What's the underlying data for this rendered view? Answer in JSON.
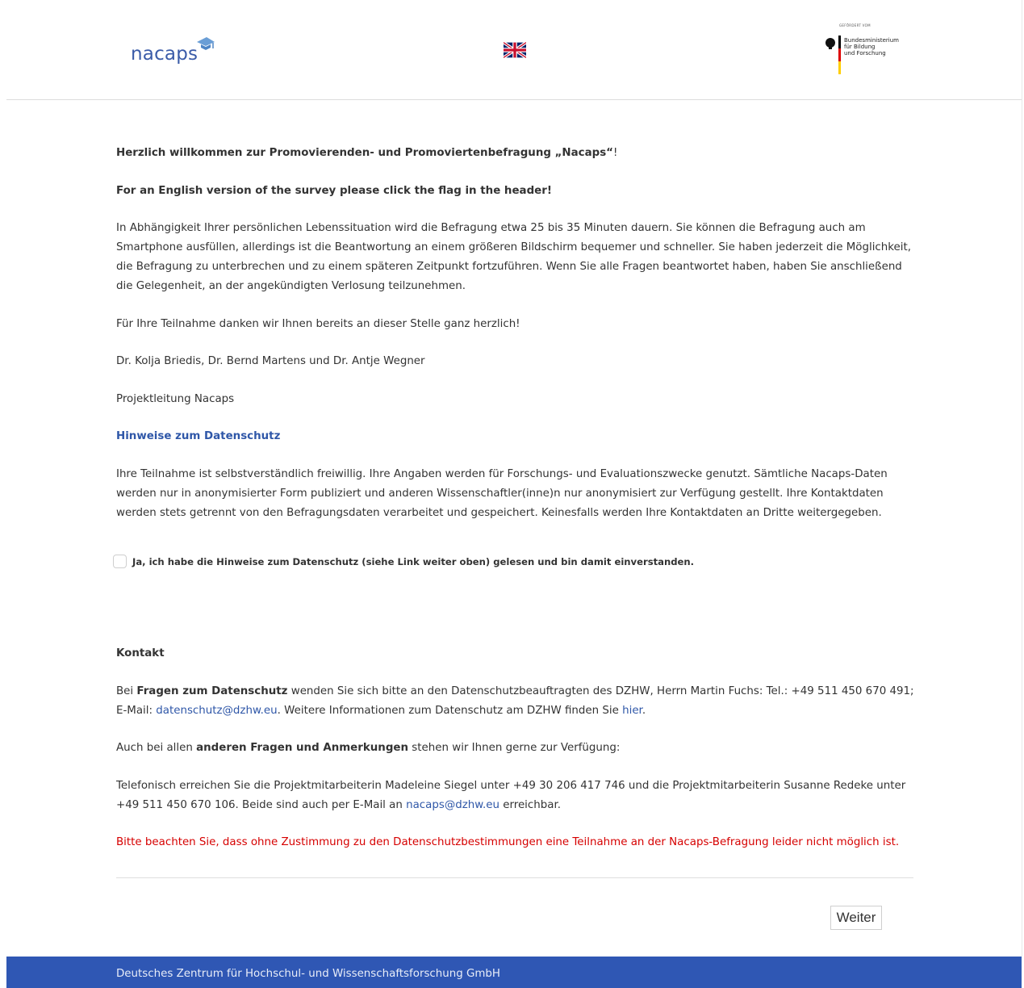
{
  "header": {
    "logo_text": "nacaps",
    "flag_icon": "uk-flag-icon",
    "bmbf": {
      "top_text": "GEFÖRDERT VOM",
      "name_lines": "Bundesministerium\nfür Bildung\nund Forschung"
    }
  },
  "intro": {
    "welcome_prefix": "Herzlich willkommen zur Promovierenden- und Promoviertenbefragung „Nacaps“",
    "welcome_suffix": "!",
    "english_note": "For an English version of the survey please click the flag in the header!",
    "paragraph1": "In Abhängigkeit Ihrer persönlichen Lebenssituation wird die Befragung etwa 25 bis 35 Minuten dauern. Sie können die Befragung auch am Smartphone ausfüllen, allerdings ist die Beantwortung an einem größeren Bildschirm bequemer und schneller. Sie haben jederzeit die Möglichkeit, die Befragung zu unterbrechen und zu einem späteren Zeitpunkt fortzuführen. Wenn Sie alle Fragen beantwortet haben, haben Sie anschließend die Gelegenheit, an der angekündigten Verlosung teilzunehmen.",
    "thanks": "Für Ihre Teilnahme danken wir Ihnen bereits an dieser Stelle ganz herzlich!",
    "signatories": "Dr. Kolja Briedis, Dr. Bernd Martens und Dr. Antje Wegner",
    "role": "Projektleitung Nacaps",
    "privacy_link": "Hinweise zum Datenschutz",
    "privacy_text": "Ihre Teilnahme ist selbstverständlich freiwillig. Ihre Angaben werden für Forschungs- und Evaluationszwecke genutzt. Sämtliche Nacaps-Daten werden nur in anonymisierter Form publiziert und anderen Wissenschaftler(inne)n nur anonymisiert zur Verfügung gestellt. Ihre Kontaktdaten werden stets getrennt von den Befragungsdaten verarbeitet und gespeichert. Keinesfalls werden Ihre Kontaktdaten an Dritte weitergegeben."
  },
  "consent": {
    "checked": false,
    "label": "Ja, ich habe die Hinweise zum Datenschutz (siehe Link weiter oben) gelesen und bin damit einverstanden."
  },
  "contact": {
    "heading": "Kontakt",
    "p1_a": "Bei ",
    "p1_bold": "Fragen zum Datenschutz",
    "p1_b": " wenden Sie sich bitte an den Datenschutzbeauftragten des DZHW, Herrn Martin Fuchs: Tel.: +49 511 450 670 491; E-Mail: ",
    "p1_email": "datenschutz@dzhw.eu",
    "p1_c": ". Weitere Informationen zum Datenschutz am DZHW finden Sie ",
    "p1_link": "hier",
    "p1_d": ".",
    "p2_a": "Auch bei allen ",
    "p2_bold": "anderen Fragen und Anmerkungen",
    "p2_b": " stehen wir Ihnen gerne zur Verfügung:",
    "p3_a": "Telefonisch erreichen Sie die Projektmitarbeiterin Madeleine Siegel unter +49 30 206 417 746 und die Projektmitarbeiterin Susanne Redeke unter +49 511 450 670 106. Beide sind auch per E-Mail an ",
    "p3_email": "nacaps@dzhw.eu",
    "p3_b": " erreichbar.",
    "warning": "Bitte beachten Sie, dass ohne Zustimmung zu den Datenschutzbestimmungen eine Teilnahme an der Nacaps-Befragung leider nicht möglich ist."
  },
  "buttons": {
    "next": "Weiter"
  },
  "footer": {
    "text": "Deutsches Zentrum für Hochschul- und Wissenschaftsforschung GmbH"
  },
  "colors": {
    "brand_blue": "#2f57b4",
    "link_blue": "#2f57a8",
    "warning_red": "#d60000"
  }
}
